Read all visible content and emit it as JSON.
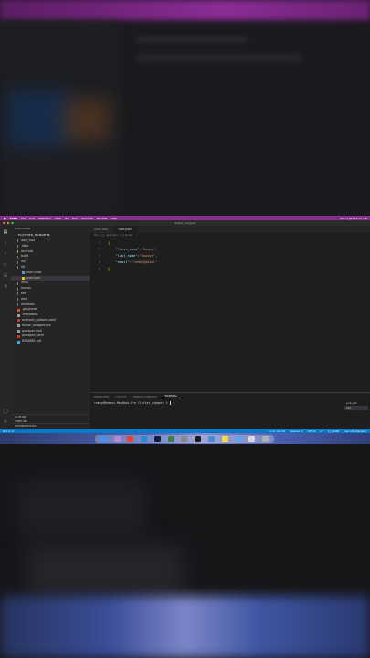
{
  "menubar": {
    "app": "Code",
    "items": [
      "File",
      "Edit",
      "Selection",
      "View",
      "Go",
      "Run",
      "Terminal",
      "Window",
      "Help"
    ],
    "clock": "Mon 1 Jan 12:37 AM"
  },
  "window_title": "flutter_widgets",
  "sidebar": {
    "header": "EXPLORER",
    "project": "FLUTTER_WIDGETS",
    "items": [
      {
        "label": "dart_tool",
        "indent": 1,
        "kind": "folder",
        "color": "#7c7c7c"
      },
      {
        "label": ".idea",
        "indent": 1,
        "kind": "folder",
        "color": "#7c7c7c"
      },
      {
        "label": "android",
        "indent": 1,
        "kind": "folder",
        "color": "#8bc34a"
      },
      {
        "label": "build",
        "indent": 1,
        "kind": "folder",
        "color": "#7c7c7c"
      },
      {
        "label": "ios",
        "indent": 1,
        "kind": "folder",
        "color": "#7c7c7c"
      },
      {
        "label": "lib",
        "indent": 1,
        "kind": "folder",
        "color": "#7c7c7c"
      },
      {
        "label": "main.dart",
        "indent": 2,
        "kind": "file",
        "color": "#42a5f5"
      },
      {
        "label": "user.json",
        "indent": 2,
        "kind": "file",
        "color": "#f1c40f",
        "selected": true
      },
      {
        "label": "linux",
        "indent": 1,
        "kind": "folder",
        "color": "#7c7c7c"
      },
      {
        "label": "macos",
        "indent": 1,
        "kind": "folder",
        "color": "#7c7c7c"
      },
      {
        "label": "test",
        "indent": 1,
        "kind": "folder",
        "color": "#7c7c7c"
      },
      {
        "label": "web",
        "indent": 1,
        "kind": "folder",
        "color": "#7c7c7c"
      },
      {
        "label": "windows",
        "indent": 1,
        "kind": "folder",
        "color": "#7c7c7c"
      },
      {
        "label": ".gitignore",
        "indent": 1,
        "kind": "file",
        "color": "#e64a19"
      },
      {
        "label": ".metadata",
        "indent": 1,
        "kind": "file",
        "color": "#9e9e9e"
      },
      {
        "label": "analysis_options.yaml",
        "indent": 1,
        "kind": "file",
        "color": "#c0392b"
      },
      {
        "label": "flutter_widgets.iml",
        "indent": 1,
        "kind": "file",
        "color": "#9e9e9e"
      },
      {
        "label": "pubspec.lock",
        "indent": 1,
        "kind": "file",
        "color": "#9e9e9e"
      },
      {
        "label": "pubspec.yaml",
        "indent": 1,
        "kind": "file",
        "color": "#c0392b"
      },
      {
        "label": "README.md",
        "indent": 1,
        "kind": "file",
        "color": "#42a5f5"
      }
    ],
    "outline": "OUTLINE",
    "timeline": "TIMELINE",
    "dependencies": "DEPENDENCIES"
  },
  "editor": {
    "tabs": [
      {
        "label": "main.dart",
        "active": false
      },
      {
        "label": "user.json",
        "active": true
      }
    ],
    "breadcrumb": "lib > {} user.json > [] email",
    "lines": [
      {
        "n": "1",
        "parts": [
          {
            "t": "{",
            "c": "brace"
          }
        ]
      },
      {
        "n": "2",
        "parts": [
          {
            "t": "    ",
            "c": ""
          },
          {
            "t": "\"first_name\"",
            "c": "key"
          },
          {
            "t": ":",
            "c": ""
          },
          {
            "t": "\"Remmy\"",
            "c": "str"
          },
          {
            "t": ",",
            "c": ""
          }
        ]
      },
      {
        "n": "3",
        "parts": [
          {
            "t": "    ",
            "c": ""
          },
          {
            "t": "\"last_name\"",
            "c": "key"
          },
          {
            "t": ":",
            "c": ""
          },
          {
            "t": "\"Okoaye\"",
            "c": "str"
          },
          {
            "t": ",",
            "c": ""
          }
        ]
      },
      {
        "n": "4",
        "parts": [
          {
            "t": "    ",
            "c": ""
          },
          {
            "t": "\"email\"",
            "c": "key"
          },
          {
            "t": ":",
            "c": ""
          },
          {
            "t": "\"remmy@gmail\"",
            "c": "str"
          }
        ]
      },
      {
        "n": "5",
        "parts": [
          {
            "t": "}",
            "c": "brace"
          }
        ]
      }
    ]
  },
  "panel": {
    "tabs": [
      "PROBLEMS",
      "OUTPUT",
      "DEBUG CONSOLE",
      "TERMINAL"
    ],
    "active_tab": "TERMINAL",
    "prompt": "remmy@Remmys-MacBook-Pro flutter_widgets %",
    "terminals": [
      "pub get",
      "zsh"
    ]
  },
  "statusbar": {
    "left": "⊗ 0 ⚠ 0",
    "right": [
      "Ln 4, Col 29",
      "Spaces: 4",
      "UTF-8",
      "LF",
      "{} JSON",
      "mac OS (darwin)"
    ]
  },
  "colors": {
    "accent_menubar": "#8b2f93",
    "statusbar": "#007acc",
    "editor_bg": "#1e1e1e"
  }
}
